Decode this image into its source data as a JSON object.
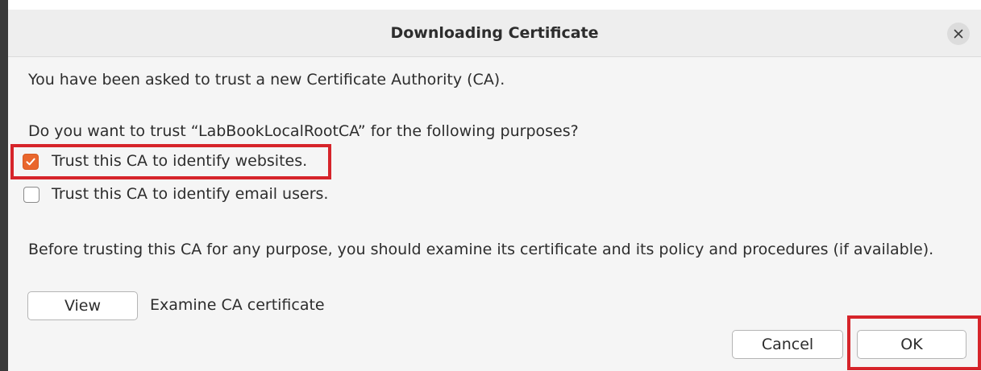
{
  "dialog": {
    "title": "Downloading Certificate",
    "intro": "You have been asked to trust a new Certificate Authority (CA).",
    "question": "Do you want to trust “LabBookLocalRootCA” for the following purposes?",
    "options": [
      {
        "label": "Trust this CA to identify websites.",
        "checked": true
      },
      {
        "label": "Trust this CA to identify email users.",
        "checked": false
      }
    ],
    "advice": "Before trusting this CA for any purpose, you should examine its certificate and its policy and procedures (if available).",
    "view_button": "View",
    "view_caption": "Examine CA certificate",
    "cancel_button": "Cancel",
    "ok_button": "OK"
  },
  "colors": {
    "accent": "#e9662c",
    "highlight": "#d6242a"
  },
  "icons": {
    "close": "close-icon",
    "check": "checkmark-icon"
  }
}
